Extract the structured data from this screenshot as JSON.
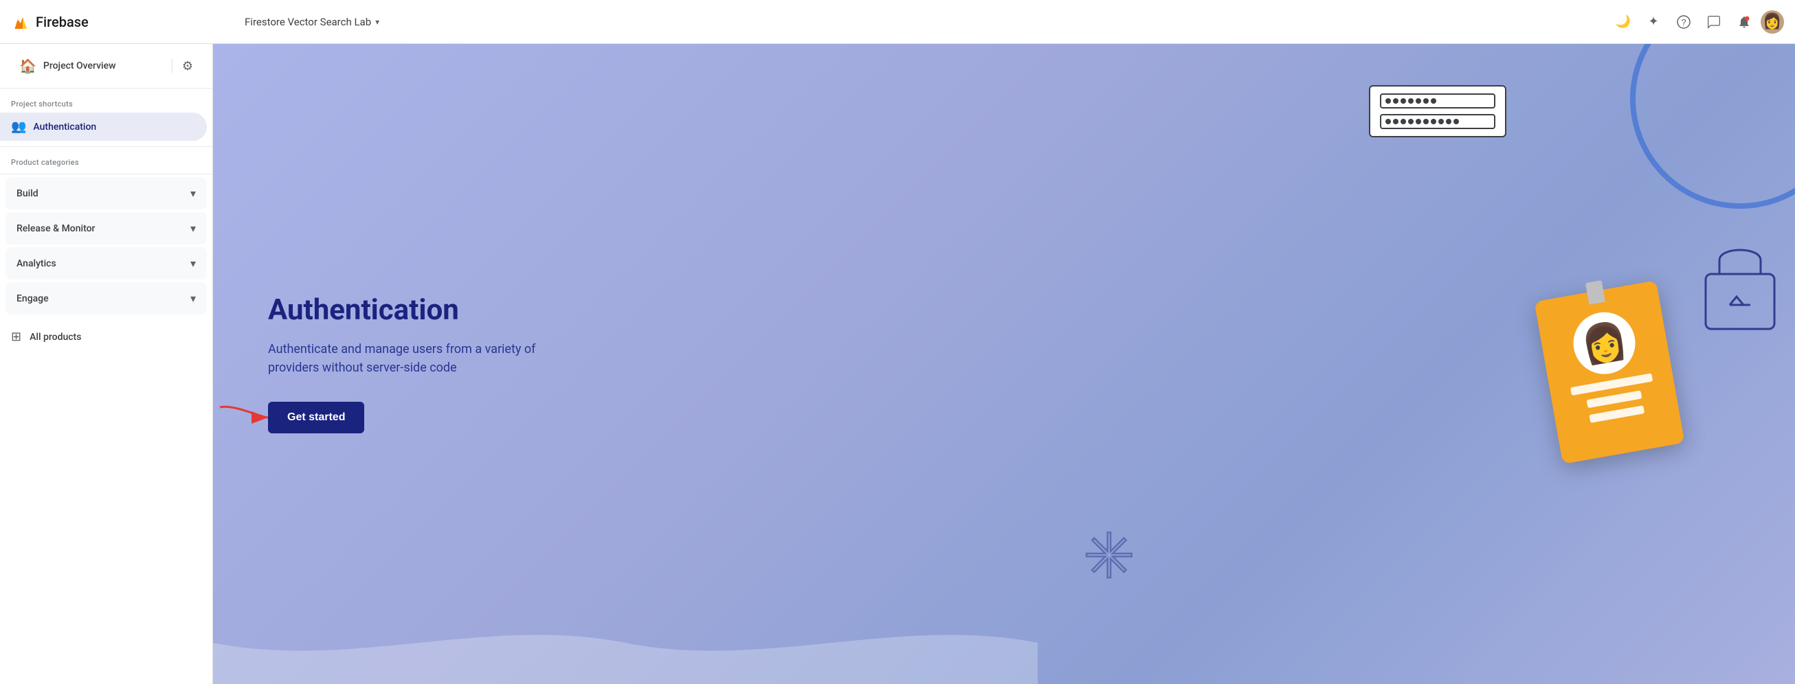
{
  "app": {
    "title": "Firebase"
  },
  "topnav": {
    "project_name": "Firestore Vector Search Lab",
    "dropdown_arrow": "▾",
    "icons": {
      "dark_mode": "🌙",
      "sparkle": "✦",
      "help": "?",
      "chat": "💬",
      "notification": "🔔"
    }
  },
  "sidebar": {
    "project_overview_label": "Project Overview",
    "section_label_shortcuts": "Project shortcuts",
    "auth_item_label": "Authentication",
    "section_label_categories": "Product categories",
    "categories": [
      {
        "label": "Build"
      },
      {
        "label": "Release & Monitor"
      },
      {
        "label": "Analytics"
      },
      {
        "label": "Engage"
      }
    ],
    "all_products_label": "All products"
  },
  "main": {
    "heading": "Authentication",
    "description": "Authenticate and manage users from a variety of providers without server-side code",
    "get_started_label": "Get started"
  }
}
